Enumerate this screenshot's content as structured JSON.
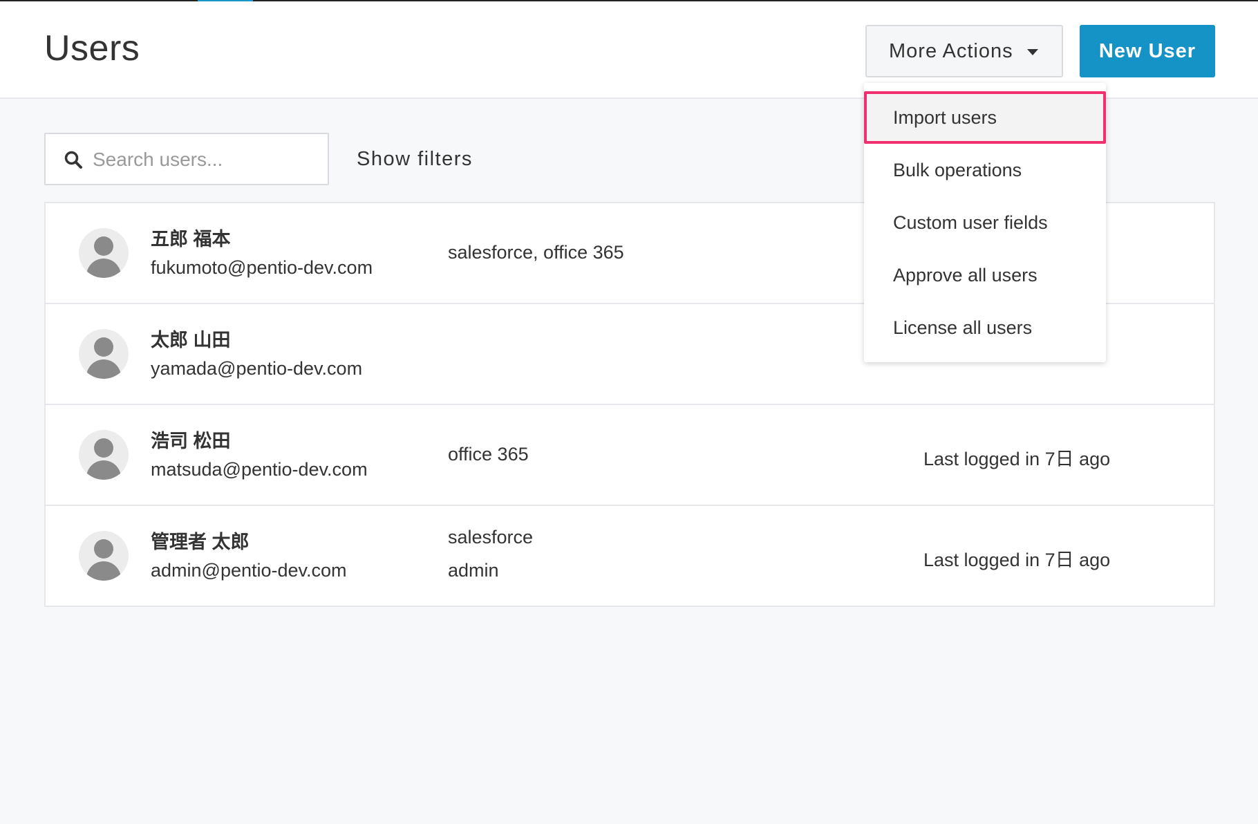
{
  "header": {
    "title": "Users",
    "more_actions_label": "More Actions",
    "new_user_label": "New User"
  },
  "search": {
    "placeholder": "Search users...",
    "value": ""
  },
  "filters": {
    "label": "Show filters"
  },
  "dropdown": {
    "items": [
      {
        "label": "Import users",
        "highlighted": true
      },
      {
        "label": "Bulk operations"
      },
      {
        "label": "Custom user fields"
      },
      {
        "label": "Approve all users"
      },
      {
        "label": "License all users"
      }
    ]
  },
  "users": [
    {
      "name": "五郎 福本",
      "email": "fukumoto@pentio-dev.com",
      "apps": "salesforce, office 365",
      "apps_line2": "",
      "last_login": ""
    },
    {
      "name": "太郎 山田",
      "email": "yamada@pentio-dev.com",
      "apps": "",
      "apps_line2": "",
      "last_login": ""
    },
    {
      "name": "浩司 松田",
      "email": "matsuda@pentio-dev.com",
      "apps": "office 365",
      "apps_line2": "",
      "last_login": "Last logged in 7日 ago"
    },
    {
      "name": "管理者 太郎",
      "email": "admin@pentio-dev.com",
      "apps": "salesforce",
      "apps_line2": "admin",
      "last_login": "Last logged in 7日 ago"
    }
  ],
  "colors": {
    "primary": "#1593c6",
    "highlight_border": "#f0306e",
    "background": "#f7f8fa"
  }
}
